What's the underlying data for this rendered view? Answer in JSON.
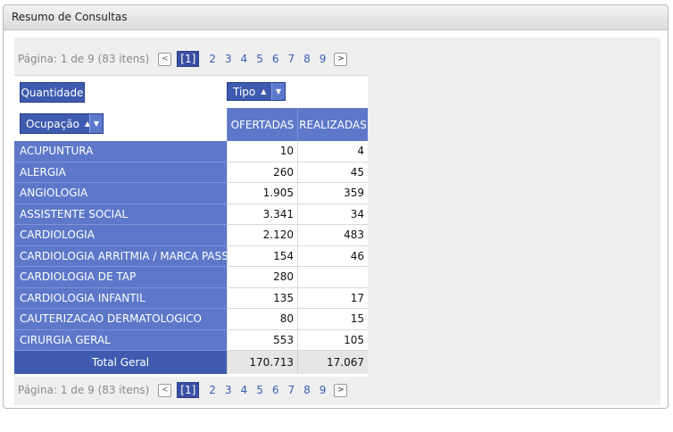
{
  "panel": {
    "title": "Resumo de Consultas"
  },
  "pager": {
    "info": "Página: 1 de 9 (83 itens)",
    "prev": "<",
    "next": ">",
    "current": "[1]",
    "pages": [
      "2",
      "3",
      "4",
      "5",
      "6",
      "7",
      "8",
      "9"
    ]
  },
  "grid": {
    "quantidade_label": "Quantidade",
    "tipo_label": "Tipo",
    "ocupacao_label": "Ocupação",
    "sort_glyph": "▲",
    "dropdown_glyph": "▼",
    "columns": [
      "OFERTADAS",
      "REALIZADAS"
    ],
    "rows": [
      {
        "name": "ACUPUNTURA",
        "ofertadas": "10",
        "realizadas": "4"
      },
      {
        "name": "ALERGIA",
        "ofertadas": "260",
        "realizadas": "45"
      },
      {
        "name": "ANGIOLOGIA",
        "ofertadas": "1.905",
        "realizadas": "359"
      },
      {
        "name": "ASSISTENTE SOCIAL",
        "ofertadas": "3.341",
        "realizadas": "34"
      },
      {
        "name": "CARDIOLOGIA",
        "ofertadas": "2.120",
        "realizadas": "483"
      },
      {
        "name": "CARDIOLOGIA ARRITMIA / MARCA PASSO",
        "ofertadas": "154",
        "realizadas": "46"
      },
      {
        "name": "CARDIOLOGIA DE TAP",
        "ofertadas": "280",
        "realizadas": ""
      },
      {
        "name": "CARDIOLOGIA INFANTIL",
        "ofertadas": "135",
        "realizadas": "17"
      },
      {
        "name": "CAUTERIZACAO DERMATOLOGICO",
        "ofertadas": "80",
        "realizadas": "15"
      },
      {
        "name": "CIRURGIA GERAL",
        "ofertadas": "553",
        "realizadas": "105"
      }
    ],
    "total": {
      "label": "Total Geral",
      "ofertadas": "170.713",
      "realizadas": "17.067"
    }
  }
}
